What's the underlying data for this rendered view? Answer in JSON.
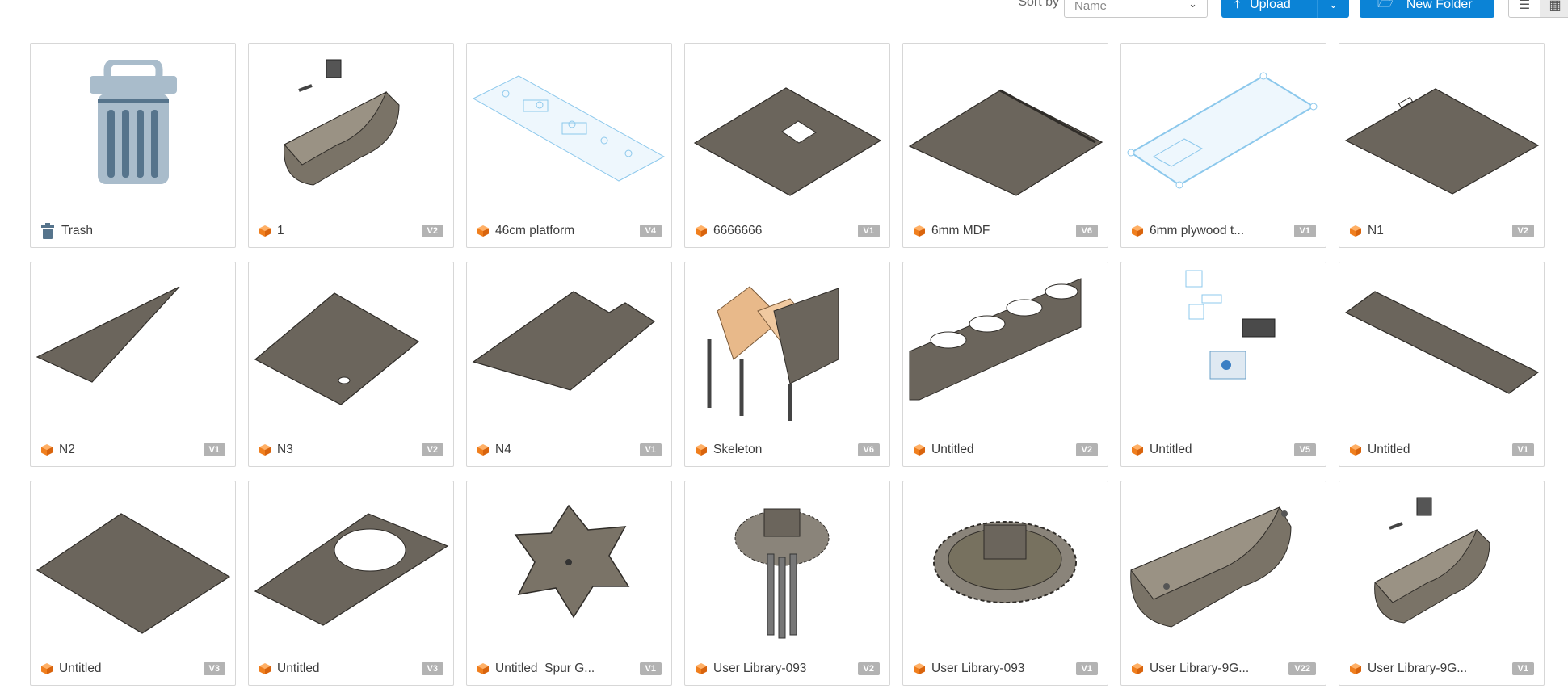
{
  "toolbar": {
    "sort_label": "Sort by",
    "sort_value": "Name",
    "upload_label": "Upload",
    "new_folder_label": "New Folder"
  },
  "colors": {
    "accent": "#0b83d6",
    "cube": "#f07f1e",
    "plate": "#6b655c",
    "version_badge": "#b3b3b3",
    "wire": "#8cc8ec"
  },
  "tiles": [
    {
      "name": "Trash",
      "version": "",
      "thumb": "trash-icon"
    },
    {
      "name": "1",
      "version": "V2",
      "thumb": "trough-assembly"
    },
    {
      "name": "46cm platform",
      "version": "V4",
      "thumb": "wire-platform"
    },
    {
      "name": "6666666",
      "version": "V1",
      "thumb": "plate-square-hole"
    },
    {
      "name": "6mm MDF",
      "version": "V6",
      "thumb": "plate-slot"
    },
    {
      "name": "6mm plywood t...",
      "version": "V1",
      "thumb": "wire-plate"
    },
    {
      "name": "N1",
      "version": "V2",
      "thumb": "plate-small-slot"
    },
    {
      "name": "N2",
      "version": "V1",
      "thumb": "triangle-plate"
    },
    {
      "name": "N3",
      "version": "V2",
      "thumb": "plate-round-hole"
    },
    {
      "name": "N4",
      "version": "V1",
      "thumb": "plate-notched"
    },
    {
      "name": "Skeleton",
      "version": "V6",
      "thumb": "skeleton-frame"
    },
    {
      "name": "Untitled",
      "version": "V2",
      "thumb": "bottle-rack"
    },
    {
      "name": "Untitled",
      "version": "V5",
      "thumb": "exploded-parts"
    },
    {
      "name": "Untitled",
      "version": "V1",
      "thumb": "long-plate"
    },
    {
      "name": "Untitled",
      "version": "V3",
      "thumb": "plate-large"
    },
    {
      "name": "Untitled",
      "version": "V3",
      "thumb": "plate-big-hole"
    },
    {
      "name": "Untitled_Spur G...",
      "version": "V1",
      "thumb": "star-gear"
    },
    {
      "name": "User Library-093",
      "version": "V2",
      "thumb": "gear-shafts"
    },
    {
      "name": "User Library-093",
      "version": "V1",
      "thumb": "spur-gear"
    },
    {
      "name": "User Library-9G...",
      "version": "V22",
      "thumb": "trough"
    },
    {
      "name": "User Library-9G...",
      "version": "V1",
      "thumb": "trough-assembly"
    }
  ]
}
